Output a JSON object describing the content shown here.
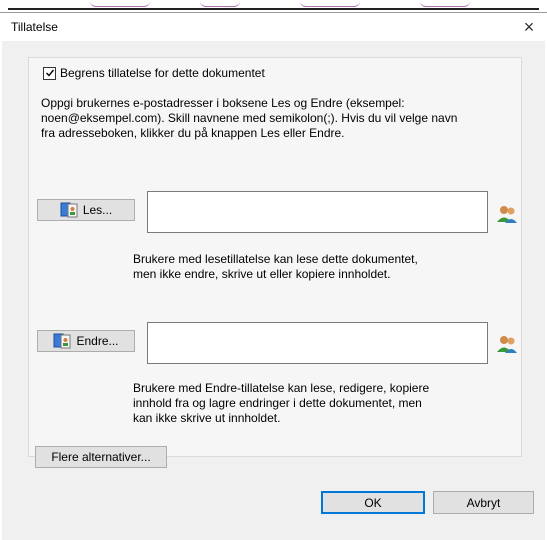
{
  "dialog": {
    "title": "Tillatelse",
    "close_glyph": "×",
    "restrict": {
      "checked": true,
      "label": "Begrens tillatelse for dette dokumentet"
    },
    "intro": [
      "Oppgi brukernes e-postadresser i boksene Les og Endre (eksempel:",
      "noen@eksempel.com). Skill navnene med semikolon(;). Hvis du vil velge navn",
      "fra adresseboken, klikker du på knappen Les eller Endre."
    ],
    "read": {
      "button_label": "Les...",
      "value": "",
      "description": [
        "Brukere med lesetillatelse kan lese dette dokumentet,",
        "men ikke endre, skrive ut eller kopiere innholdet."
      ]
    },
    "change": {
      "button_label": "Endre...",
      "value": "",
      "description": [
        "Brukere med Endre-tillatelse kan lese, redigere, kopiere",
        "innhold fra og lagre endringer i dette dokumentet, men",
        "kan ikke skrive ut innholdet."
      ]
    },
    "more_options_label": "Flere alternativer...",
    "ok_label": "OK",
    "cancel_label": "Avbryt"
  },
  "icons": {
    "read_button": "address-book-icon",
    "change_button": "address-book-icon",
    "read_picker": "user-picker-icon",
    "change_picker": "user-picker-icon",
    "checkbox": "checkmark-icon"
  },
  "colors": {
    "dialog_bg": "#f0f0f0",
    "button_bg": "#e1e1e1",
    "default_button_border": "#0078d7"
  }
}
